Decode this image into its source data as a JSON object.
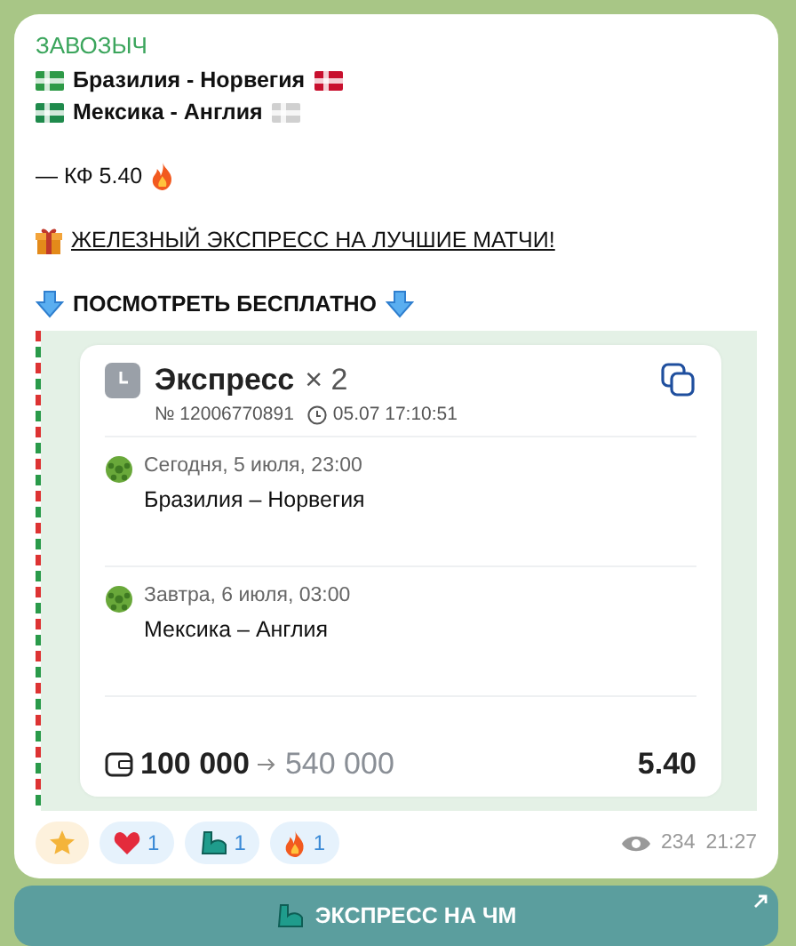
{
  "message": {
    "author": "ЗАВОЗЫЧ",
    "matches": [
      {
        "text": "Бразилия - Норвегия",
        "flags": [
          {
            "color": "#2e9a47"
          },
          {
            "color": "#c8102e"
          }
        ]
      },
      {
        "text": "Мексика - Англия",
        "flags": [
          {
            "color": "#1f8a4c"
          },
          {
            "color": "#d0d0d0"
          }
        ]
      }
    ],
    "odds_line": "— КФ 5.40",
    "promo_link": "ЖЕЛЕЗНЫЙ ЭКСПРЕСС НА ЛУЧШИЕ МАТЧИ!",
    "cta": "ПОСМОТРЕТЬ БЕСПЛАТНО",
    "bet_card": {
      "title": "Экспресс",
      "multiplier": "× 2",
      "number": "№ 12006770891",
      "timestamp": "05.07 17:10:51",
      "events": [
        {
          "date": "Сегодня, 5 июля, 23:00",
          "teams": "Бразилия – Норвегия"
        },
        {
          "date": "Завтра, 6 июля, 03:00",
          "teams": "Мексика – Англия"
        }
      ],
      "stake": "100 000",
      "payout": "540 000",
      "total_odds": "5.40"
    },
    "reactions": [
      {
        "kind": "star"
      },
      {
        "kind": "heart",
        "count": "1"
      },
      {
        "kind": "muscle",
        "count": "1"
      },
      {
        "kind": "fire",
        "count": "1"
      }
    ],
    "views": "234",
    "time": "21:27"
  },
  "inline_button": {
    "label": "ЭКСПРЕСС НА ЧМ"
  }
}
